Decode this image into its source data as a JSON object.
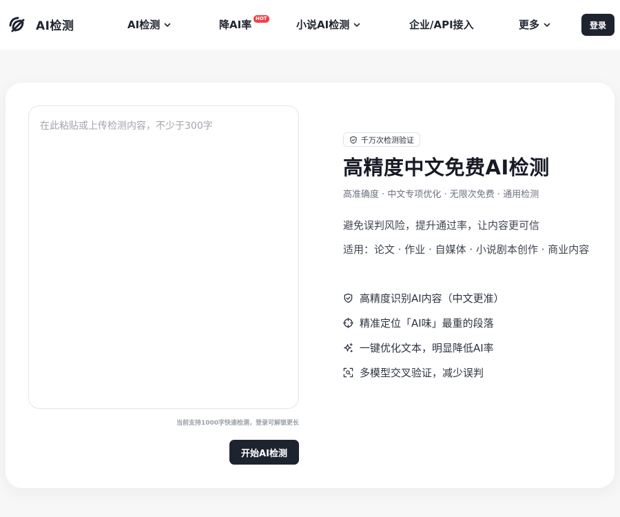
{
  "brand": {
    "name": "AI检测"
  },
  "nav": {
    "items": [
      {
        "label": "AI检测",
        "dropdown": true
      },
      {
        "label": "降AI率",
        "badge": "HOT"
      },
      {
        "label": "小说AI检测",
        "dropdown": true
      },
      {
        "label": "企业/API接入"
      },
      {
        "label": "更多",
        "dropdown": true
      }
    ],
    "login_label": "登录"
  },
  "editor": {
    "placeholder": "在此粘贴或上传检测内容，不少于300字",
    "value": "",
    "hint": "当前支持1000字快速检测，登录可解锁更长",
    "start_label": "开始AI检测"
  },
  "hero": {
    "badge": "千万次检测验证",
    "title": "高精度中文免费AI检测",
    "subtitle": "高准确度 · 中文专项优化 · 无限次免费 · 通用检测",
    "tagline": "避免误判风险，提升通过率，让内容更可信",
    "uses": "适用：论文 · 作业 · 自媒体 · 小说剧本创作 · 商业内容"
  },
  "features": [
    {
      "icon": "shield-check-icon",
      "text": "高精度识别AI内容（中文更准）"
    },
    {
      "icon": "crosshair-icon",
      "text": "精准定位「AI味」最重的段落"
    },
    {
      "icon": "sparkle-icon",
      "text": "一键优化文本，明显降低AI率"
    },
    {
      "icon": "scan-icon",
      "text": "多模型交叉验证，减少误判"
    }
  ],
  "colors": {
    "primary_dark": "#1e2330",
    "hot_badge": "#ef4444",
    "page_bg": "#f7f7f8",
    "card_bg": "#ffffff"
  }
}
